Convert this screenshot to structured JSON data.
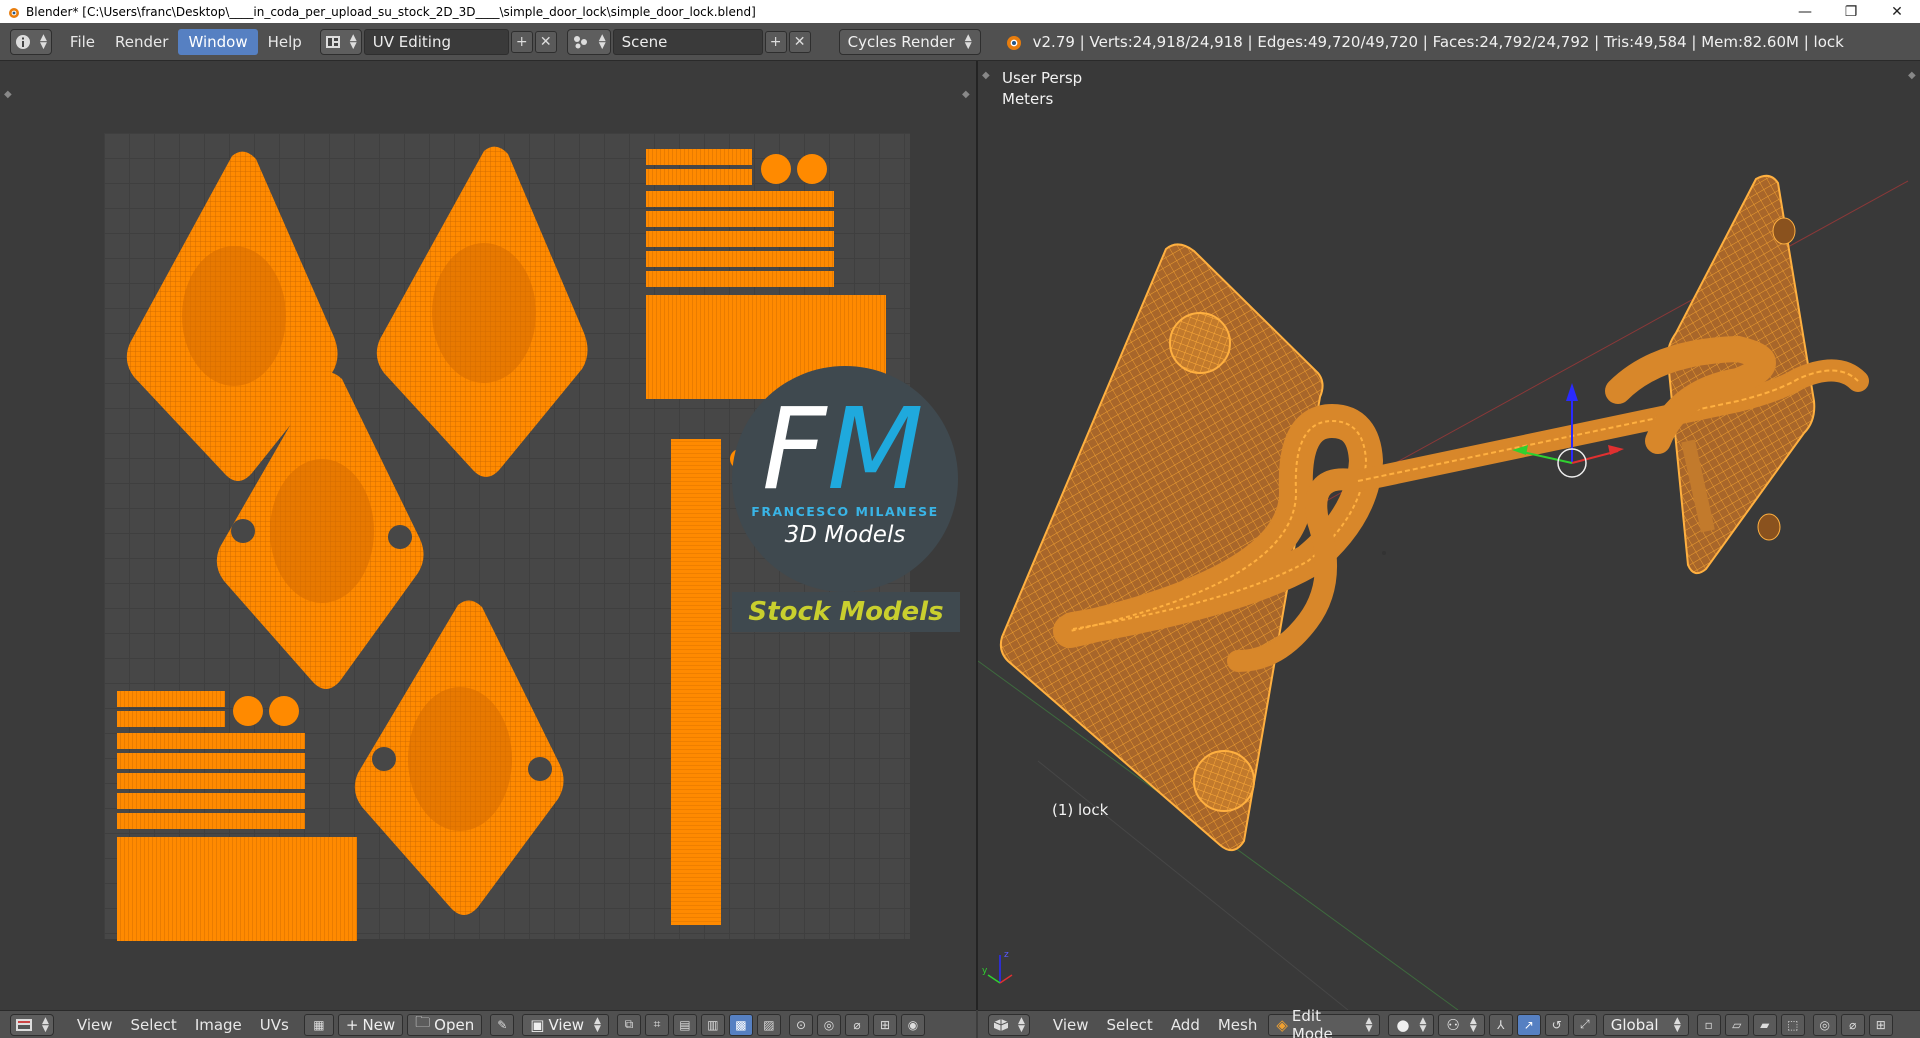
{
  "window": {
    "title": "Blender* [C:\\Users\\franc\\Desktop\\____in_coda_per_upload_su_stock_2D_3D____\\simple_door_lock\\simple_door_lock.blend]",
    "minimize_glyph": "—",
    "maximize_glyph": "❐",
    "close_glyph": "✕"
  },
  "info_header": {
    "menus": [
      "File",
      "Render",
      "Window",
      "Help"
    ],
    "active_menu": "Window",
    "screen_layout": "UV Editing",
    "scene": "Scene",
    "render_engine": "Cycles Render",
    "stats": "v2.79 | Verts:24,918/24,918 | Edges:49,720/49,720 | Faces:24,792/24,792 | Tris:49,584 | Mem:82.60M | lock"
  },
  "uv_editor": {
    "menus": [
      "View",
      "Select",
      "Image",
      "UVs"
    ],
    "new_label": "New",
    "open_label": "Open",
    "view_label": "View"
  },
  "viewport": {
    "view_name": "User Persp",
    "units": "Meters",
    "object_label": "(1) lock",
    "menus": [
      "View",
      "Select",
      "Add",
      "Mesh"
    ],
    "mode": "Edit Mode",
    "orientation": "Global"
  },
  "watermark": {
    "logo_letters_f": "F",
    "logo_letters_m": "M",
    "name": "FRANCESCO MILANESE",
    "tagline": "3D Models",
    "banner": "Stock Models"
  },
  "colors": {
    "uv_orange": "#ff8a00",
    "wire_orange": "#e58a1c",
    "mesh_fill": "#b06b22",
    "accent_blue": "#5680c2"
  },
  "icons": [
    "blender-icon",
    "info-editor-icon",
    "screen-layout-icon",
    "scene-icon",
    "cycles-icon",
    "image-editor-icon",
    "3d-view-icon"
  ]
}
